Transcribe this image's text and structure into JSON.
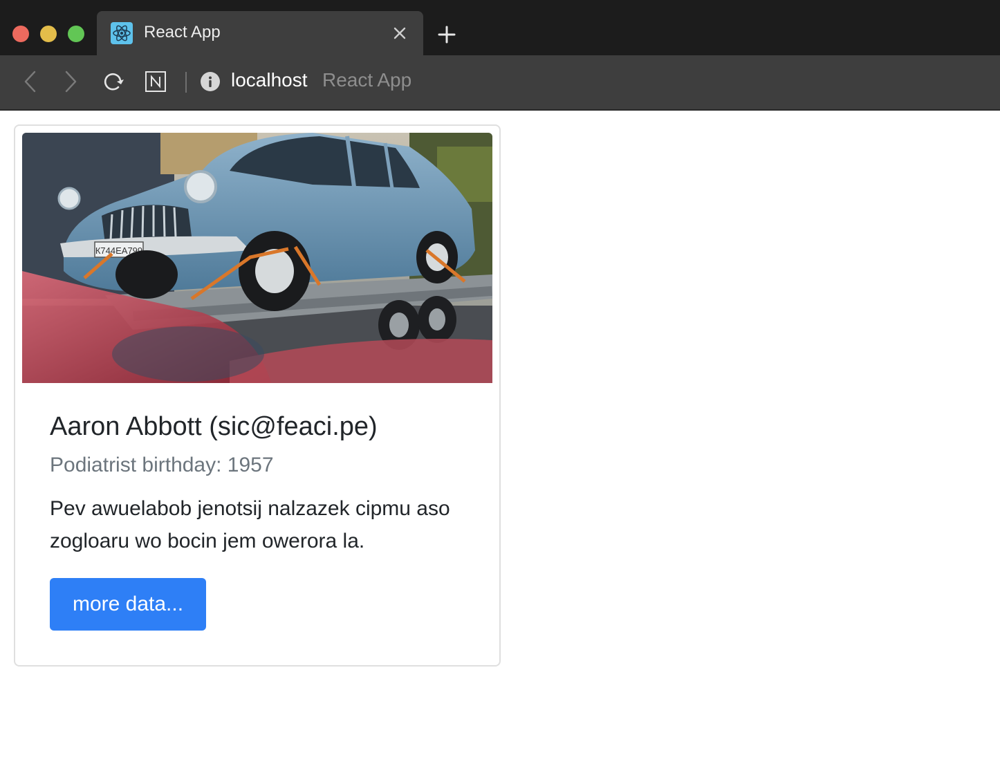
{
  "browser": {
    "tab": {
      "title": "React App",
      "favicon": "react-atom-icon"
    },
    "address_bar": {
      "host": "localhost",
      "page_title": "React App"
    },
    "icons": {
      "back": "chevron-left-icon",
      "forward": "chevron-right-icon",
      "reload": "reload-icon",
      "extension": "notion-icon",
      "site_info": "info-icon",
      "close_tab": "close-icon",
      "new_tab": "plus-icon"
    },
    "colors": {
      "close": "#ed6a5e",
      "minimize": "#e3bd4a",
      "zoom": "#62c655"
    }
  },
  "card": {
    "image_alt": "Vintage blue sedan strapped onto a car trailer",
    "title": "Aaron Abbott (sic@feaci.pe)",
    "subtitle": "Podiatrist birthday: 1957",
    "text": "Pev awuelabob jenotsij nalzazek cipmu aso zogloaru wo bocin jem owerora la.",
    "button_label": "more data...",
    "button_color": "#2e7ff6"
  }
}
